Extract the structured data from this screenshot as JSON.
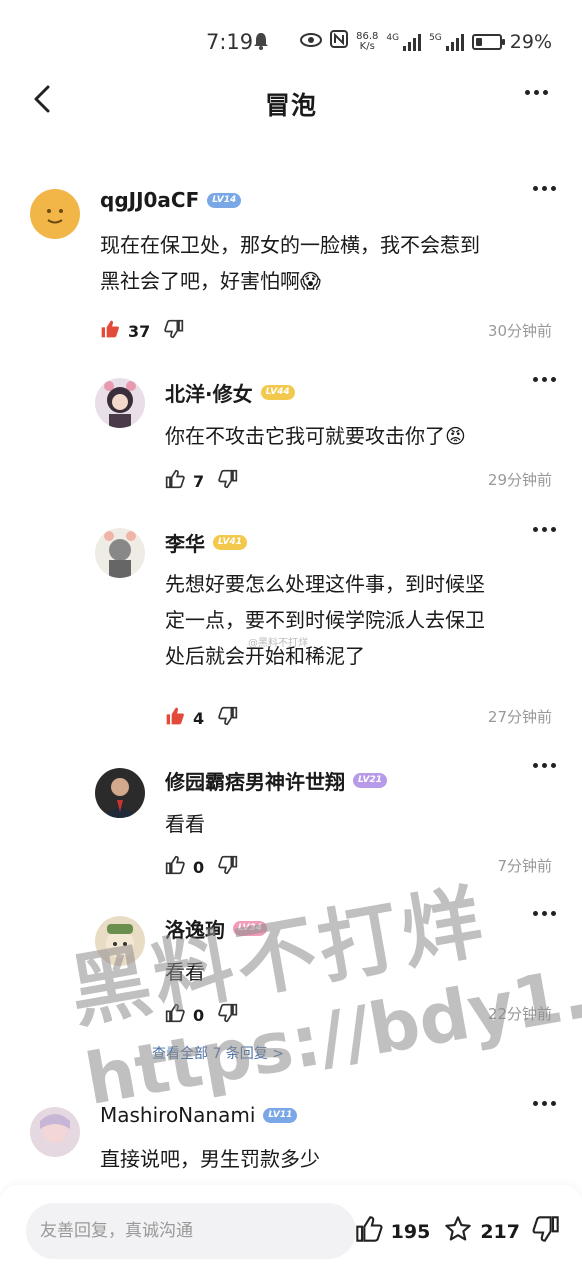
{
  "status_bar": {
    "time": "7:19",
    "net_speed_value": "86.8",
    "net_speed_unit": "K/s",
    "sim1": "4G",
    "sim2": "5G",
    "battery_percent": "29%",
    "battery_level": 0.29
  },
  "header": {
    "title": "冒泡"
  },
  "comments": [
    {
      "username": "qgJJ0aCF",
      "level": "LV14",
      "level_color": "#7aa7e6",
      "text_lines": [
        "现在在保卫处，那女的一脸横，我不会惹到",
        "黑社会了吧，好害怕啊😱"
      ],
      "likes": "37",
      "liked": true,
      "time": "30分钟前"
    },
    {
      "username": "北洋·修女",
      "level": "LV44",
      "level_color": "#f2c94c",
      "text_lines": [
        "你在不攻击它我可就要攻击你了😡"
      ],
      "likes": "7",
      "liked": false,
      "time": "29分钟前"
    },
    {
      "username": "李华",
      "level": "LV41",
      "level_color": "#f2c94c",
      "text_lines": [
        "先想好要怎么处理这件事，到时候坚",
        "定一点，要不到时候学院派人去保卫",
        "处后就会开始和稀泥了"
      ],
      "likes": "4",
      "liked": true,
      "time": "27分钟前"
    },
    {
      "username": "修园霸痞男神许世翔",
      "level": "LV21",
      "level_color": "#b89be8",
      "text_lines": [
        "看看"
      ],
      "likes": "0",
      "liked": false,
      "time": "7分钟前"
    },
    {
      "username": "洛逸珣",
      "level": "LV34",
      "level_color": "#f29bb8",
      "text_lines": [
        "看看"
      ],
      "likes": "0",
      "liked": false,
      "time": "22分钟前"
    },
    {
      "username": "MashiroNanami",
      "level": "LV11",
      "level_color": "#7aa7e6",
      "text_lines": [
        "直接说吧，男生罚款多少"
      ]
    }
  ],
  "view_more_replies": "查看全部 7 条回复 >",
  "watermark": {
    "line1": "黑料不打烊",
    "line2": "https://bdy1.co",
    "inline": "@黑料不打烊"
  },
  "bottom_bar": {
    "reply_placeholder": "友善回复，真诚沟通",
    "likes": "195",
    "stars": "217"
  }
}
